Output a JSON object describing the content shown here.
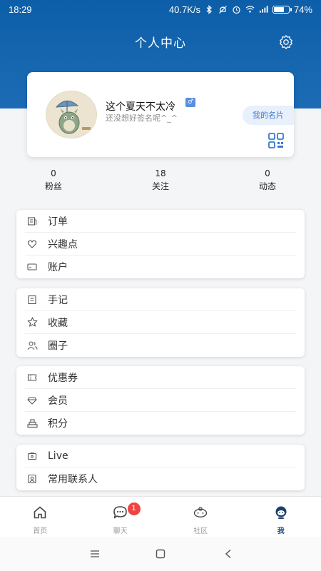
{
  "status_bar": {
    "time": "18:29",
    "network_speed": "40.7K/s",
    "battery_percent": "74%",
    "battery_level": 0.74,
    "icons": [
      "bluetooth-icon",
      "mute-icon",
      "alarm-icon",
      "wifi-icon",
      "signal-icon",
      "battery-icon"
    ]
  },
  "header": {
    "title": "个人中心",
    "settings_icon": "gear-icon"
  },
  "profile": {
    "nickname": "这个夏天不太冷",
    "gender_symbol": "♂",
    "signature": "还没想好签名呢^_^",
    "card_button": "我的名片",
    "qr_icon": "qr-code-icon"
  },
  "stats": [
    {
      "value": "0",
      "label": "粉丝"
    },
    {
      "value": "18",
      "label": "关注"
    },
    {
      "value": "0",
      "label": "动态"
    }
  ],
  "menu_groups": [
    [
      {
        "label": "订单",
        "icon": "order-icon"
      },
      {
        "label": "兴趣点",
        "icon": "heart-icon"
      },
      {
        "label": "账户",
        "icon": "card-icon"
      }
    ],
    [
      {
        "label": "手记",
        "icon": "note-icon"
      },
      {
        "label": "收藏",
        "icon": "star-icon"
      },
      {
        "label": "圈子",
        "icon": "people-icon"
      }
    ],
    [
      {
        "label": "优惠券",
        "icon": "coupon-icon"
      },
      {
        "label": "会员",
        "icon": "diamond-icon"
      },
      {
        "label": "积分",
        "icon": "points-icon"
      }
    ],
    [
      {
        "label": "Live",
        "icon": "tv-icon"
      },
      {
        "label": "常用联系人",
        "icon": "contact-icon"
      }
    ]
  ],
  "tabs": [
    {
      "label": "首页",
      "icon": "home-icon",
      "active": false
    },
    {
      "label": "聊天",
      "icon": "chat-icon",
      "active": false,
      "badge": "1"
    },
    {
      "label": "社区",
      "icon": "community-icon",
      "active": false
    },
    {
      "label": "我",
      "icon": "profile-icon",
      "active": true
    }
  ],
  "colors": {
    "header_blue": "#0d5ea8",
    "accent_blue": "#3b79d0",
    "badge_red": "#ef4444",
    "active_tab": "#1a4f8f"
  }
}
